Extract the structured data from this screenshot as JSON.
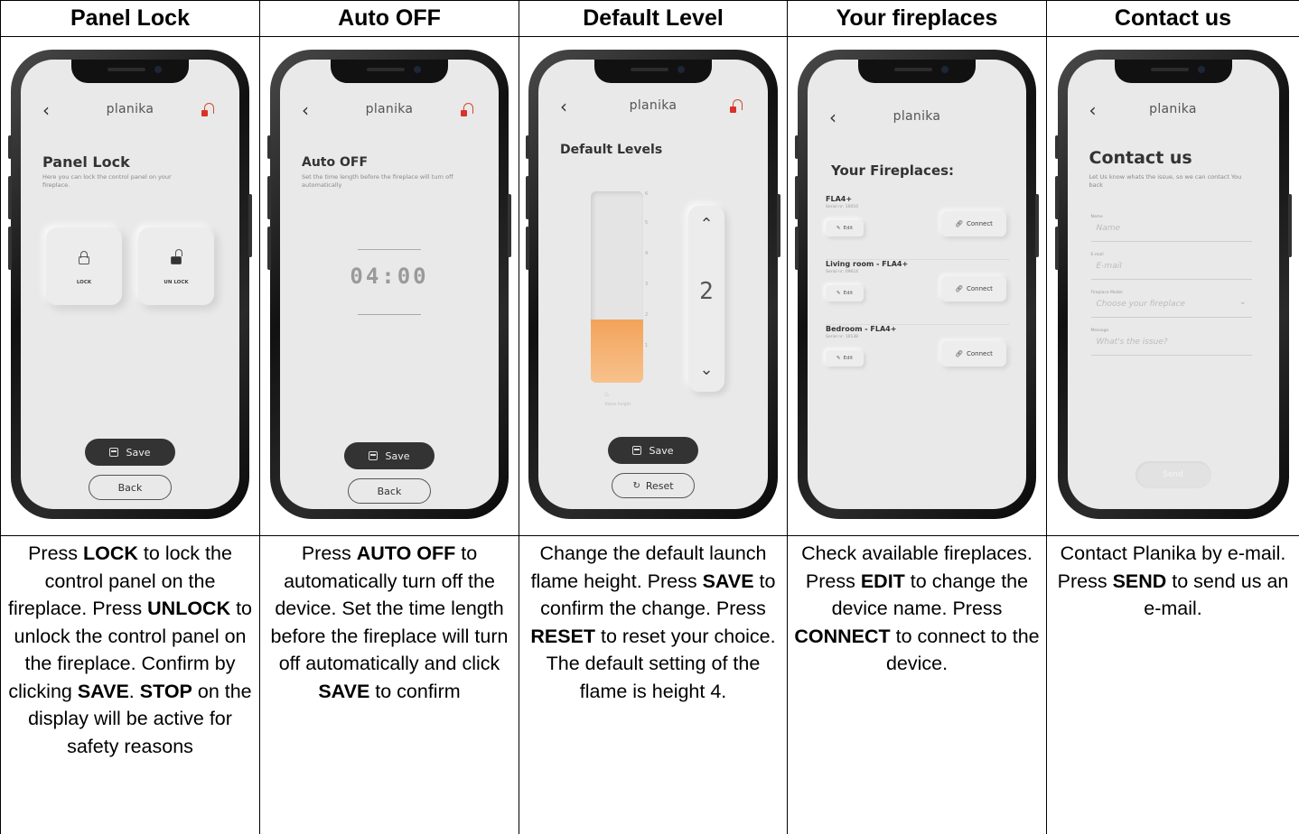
{
  "columns": [
    {
      "header": "Panel Lock",
      "screen": {
        "brand": "planika",
        "title": "Panel Lock",
        "subtitle": "Here you can lock the control panel on your fireplace.",
        "lock_label": "LOCK",
        "unlock_label": "UN LOCK",
        "save_label": "Save",
        "back_label": "Back"
      },
      "desc": [
        {
          "t": "Press "
        },
        {
          "b": "LOCK"
        },
        {
          "t": " to lock the control panel on the fireplace. Press "
        },
        {
          "b": "UNLOCK"
        },
        {
          "t": " to unlock the control panel on the fireplace. Confirm by clicking "
        },
        {
          "b": "SAVE"
        },
        {
          "t": ". "
        },
        {
          "b": "STOP"
        },
        {
          "t": " on the display will be active for safety reasons"
        }
      ]
    },
    {
      "header": "Auto OFF",
      "screen": {
        "brand": "planika",
        "title": "Auto OFF",
        "subtitle": "Set the time length before the fireplace will turn off automatically",
        "timer": "04:00",
        "save_label": "Save",
        "back_label": "Back"
      },
      "desc": [
        {
          "t": "Press "
        },
        {
          "b": "AUTO OFF"
        },
        {
          "t": " to automatically turn off the device. Set the time length before the fireplace will turn off automatically and click "
        },
        {
          "b": "SAVE"
        },
        {
          "t": " to confirm"
        }
      ]
    },
    {
      "header": "Default Level",
      "screen": {
        "brand": "planika",
        "title": "Default Levels",
        "level_value": "2",
        "fill_fraction": 0.33,
        "gauge_caption": "flame height",
        "save_label": "Save",
        "reset_label": "Reset"
      },
      "desc": [
        {
          "t": "Change the default launch flame height. Press "
        },
        {
          "b": "SAVE"
        },
        {
          "t": " to confirm the change. Press "
        },
        {
          "b": "RESET"
        },
        {
          "t": " to reset your choice. The default setting of the flame is height 4."
        }
      ]
    },
    {
      "header": "Your fireplaces",
      "screen": {
        "brand": "planika",
        "title": "Your Fireplaces:",
        "items": [
          {
            "name": "FLA4+",
            "serial": "Serial nr: 10010",
            "edit": "Edit",
            "connect": "Connect"
          },
          {
            "name": "Living room - FLA4+",
            "serial": "Serial nr: 09614",
            "edit": "Edit",
            "connect": "Connect"
          },
          {
            "name": "Bedroom - FLA4+",
            "serial": "Serial nr: 10138",
            "edit": "Edit",
            "connect": "Connect"
          }
        ]
      },
      "desc": [
        {
          "t": "Check available fireplaces. Press "
        },
        {
          "b": "EDIT"
        },
        {
          "t": " to change the device name. Press "
        },
        {
          "b": "CONNECT"
        },
        {
          "t": " to connect to the device."
        }
      ]
    },
    {
      "header": "Contact us",
      "screen": {
        "brand": "planika",
        "title": "Contact us",
        "subtitle": "Let Us know whats the issue, so we can contact You back",
        "fields": [
          {
            "label": "Name",
            "placeholder": "Name"
          },
          {
            "label": "E-mail",
            "placeholder": "E-mail"
          },
          {
            "label": "Fireplace Model",
            "placeholder": "Choose your fireplace"
          },
          {
            "label": "Message",
            "placeholder": "What's the issue?"
          }
        ],
        "send_label": "Send"
      },
      "desc": [
        {
          "t": "Contact Planika by e-mail. Press "
        },
        {
          "b": "SEND"
        },
        {
          "t": " to send us an e-mail."
        }
      ]
    }
  ],
  "colors": {
    "accent_orange": "#f3a35a",
    "bell_red": "#d8322a",
    "dark_button": "#333333"
  }
}
